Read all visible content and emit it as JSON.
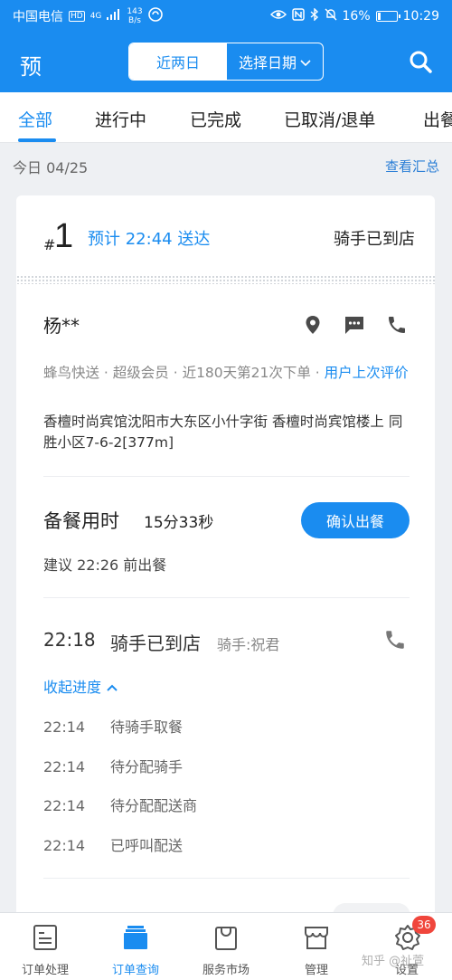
{
  "status_bar": {
    "carrier": "中国电信",
    "network_badge": "HD",
    "network_type": "4G",
    "speed_value": "143",
    "speed_unit": "B/s",
    "battery": "16%",
    "battery_level": 0.16,
    "time": "10:29"
  },
  "header": {
    "title": "预",
    "segment_recent": "近两日",
    "segment_date": "选择日期"
  },
  "tabs": [
    "全部",
    "进行中",
    "已完成",
    "已取消/退单",
    "出餐"
  ],
  "date_row": {
    "label": "今日 04/25",
    "summary_link": "查看汇总"
  },
  "order": {
    "hash": "#",
    "number": "1",
    "eta": "预计 22:44 送达",
    "state": "骑手已到店",
    "customer_name": "杨**",
    "meta": "蜂鸟快送 · 超级会员 · 近180天第21次下单 · ",
    "review_link": "用户上次评价",
    "address": "香檀时尚宾馆沈阳市大东区小什字街 香檀时尚宾馆楼上 同胜小区7-6-2[377m]",
    "prep_label": "备餐用时",
    "prep_time": "15分33秒",
    "confirm_button": "确认出餐",
    "suggest": "建议 22:26 前出餐",
    "event_time": "22:18",
    "event_text": "骑手已到店",
    "event_rider": "骑手:祝君",
    "collapse_label": "收起进度",
    "timeline": [
      {
        "time": "22:14",
        "text": "待骑手取餐"
      },
      {
        "time": "22:14",
        "text": "待分配骑手"
      },
      {
        "time": "22:14",
        "text": "待分配配送商"
      },
      {
        "time": "22:14",
        "text": "已呼叫配送"
      }
    ],
    "next_label": "…"
  },
  "bottom_nav": [
    {
      "label": "订单处理",
      "icon": "order-processing-icon"
    },
    {
      "label": "订单查询",
      "icon": "order-query-icon"
    },
    {
      "label": "服务市场",
      "icon": "service-market-icon"
    },
    {
      "label": "管理",
      "icon": "management-icon"
    },
    {
      "label": "设置",
      "icon": "settings-icon",
      "badge": "36"
    }
  ],
  "watermark": "知乎 @祉萱",
  "colors": {
    "primary": "#1a8cf0",
    "badge": "#f0463c"
  }
}
